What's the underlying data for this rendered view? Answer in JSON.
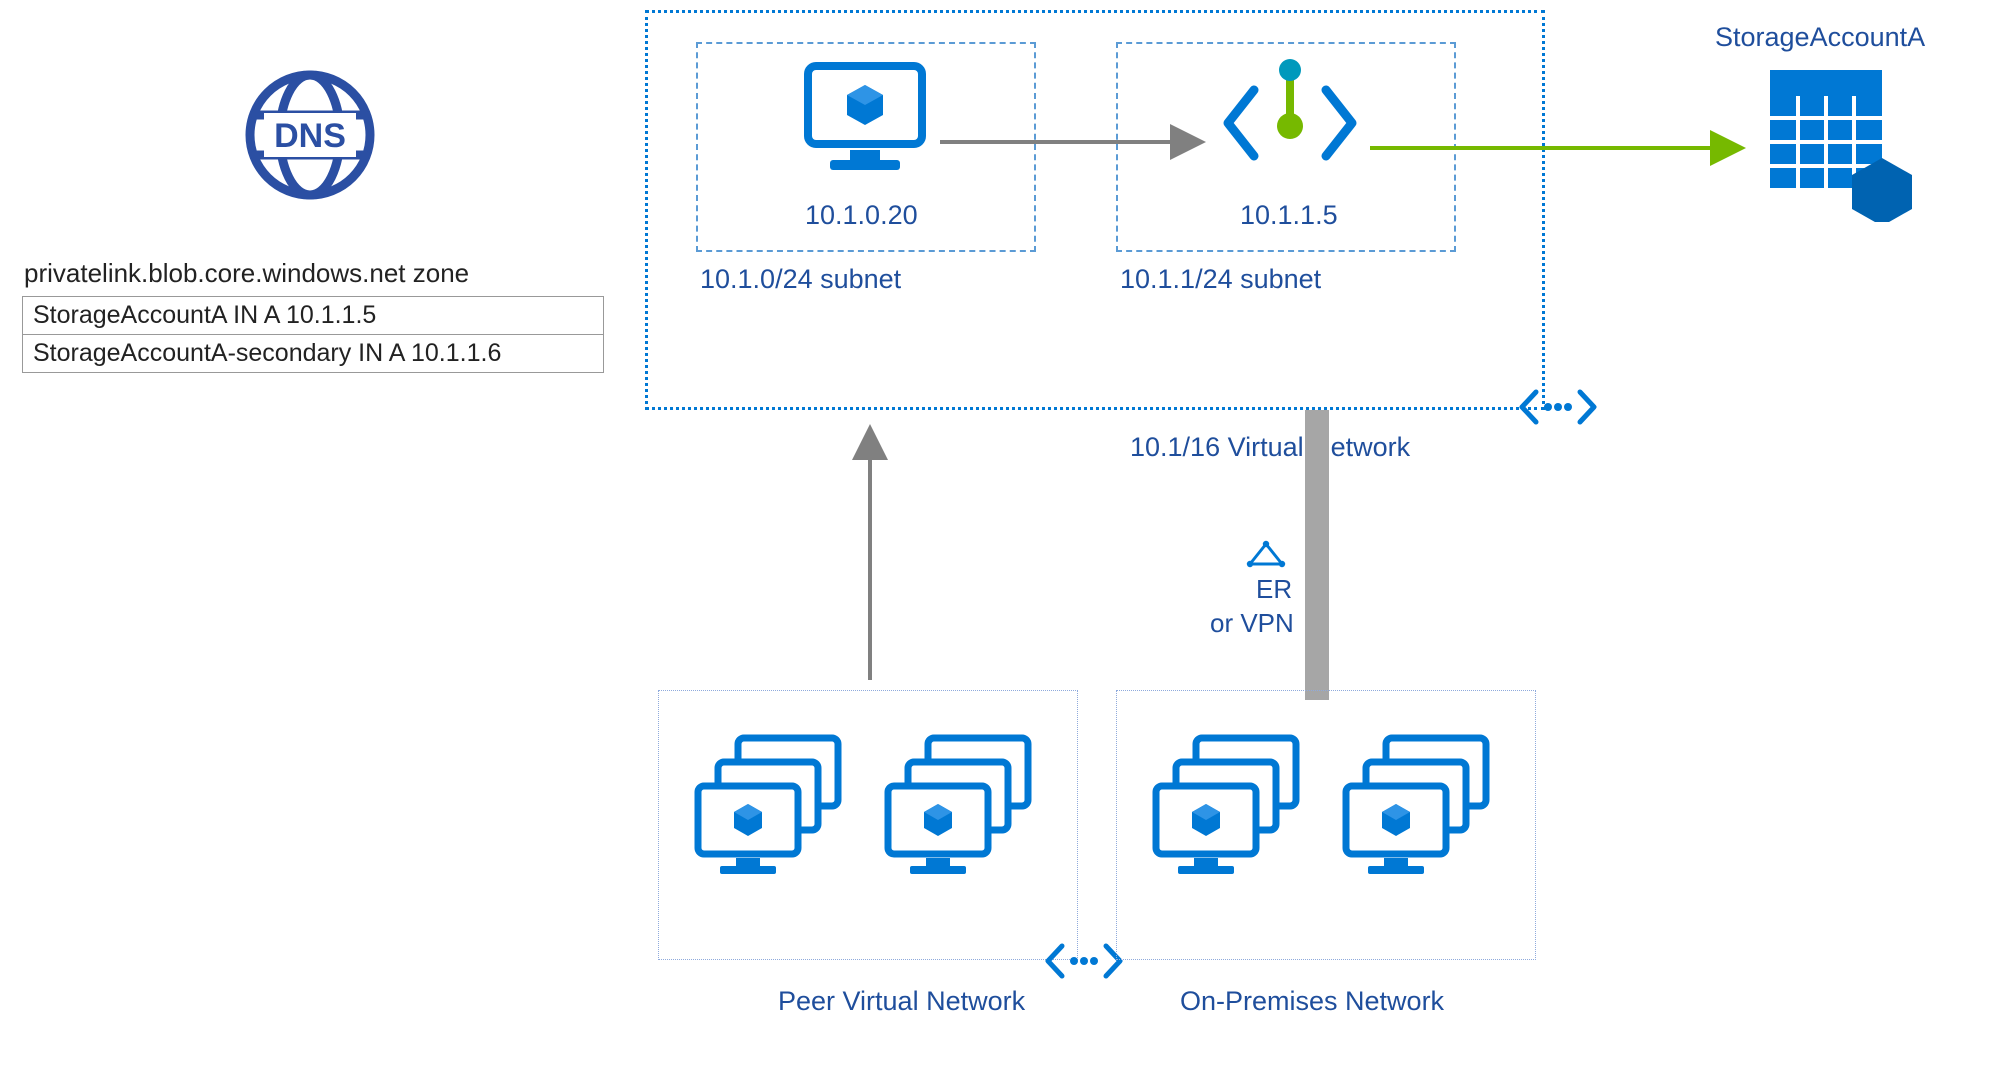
{
  "dns": {
    "zone_label": "privatelink.blob.core.windows.net zone",
    "records": [
      "StorageAccountA IN A 10.1.1.5",
      "StorageAccountA-secondary IN A 10.1.1.6"
    ]
  },
  "vnet": {
    "label": "10.1/16 Virtual Network",
    "subnets": {
      "left": {
        "ip": "10.1.0.20",
        "cidr_label": "10.1.0/24 subnet"
      },
      "right": {
        "ip": "10.1.1.5",
        "cidr_label": "10.1.1/24 subnet"
      }
    }
  },
  "connection": {
    "label_line1": "ER",
    "label_line2": "or VPN"
  },
  "networks": {
    "peer": {
      "label": "Peer Virtual Network"
    },
    "onprem": {
      "label": "On-Premises Network"
    }
  },
  "storage": {
    "label": "StorageAccountA"
  },
  "colors": {
    "azure_blue": "#0078d4",
    "dark_blue": "#1f4e9c",
    "green": "#76b900",
    "gray": "#808080"
  }
}
